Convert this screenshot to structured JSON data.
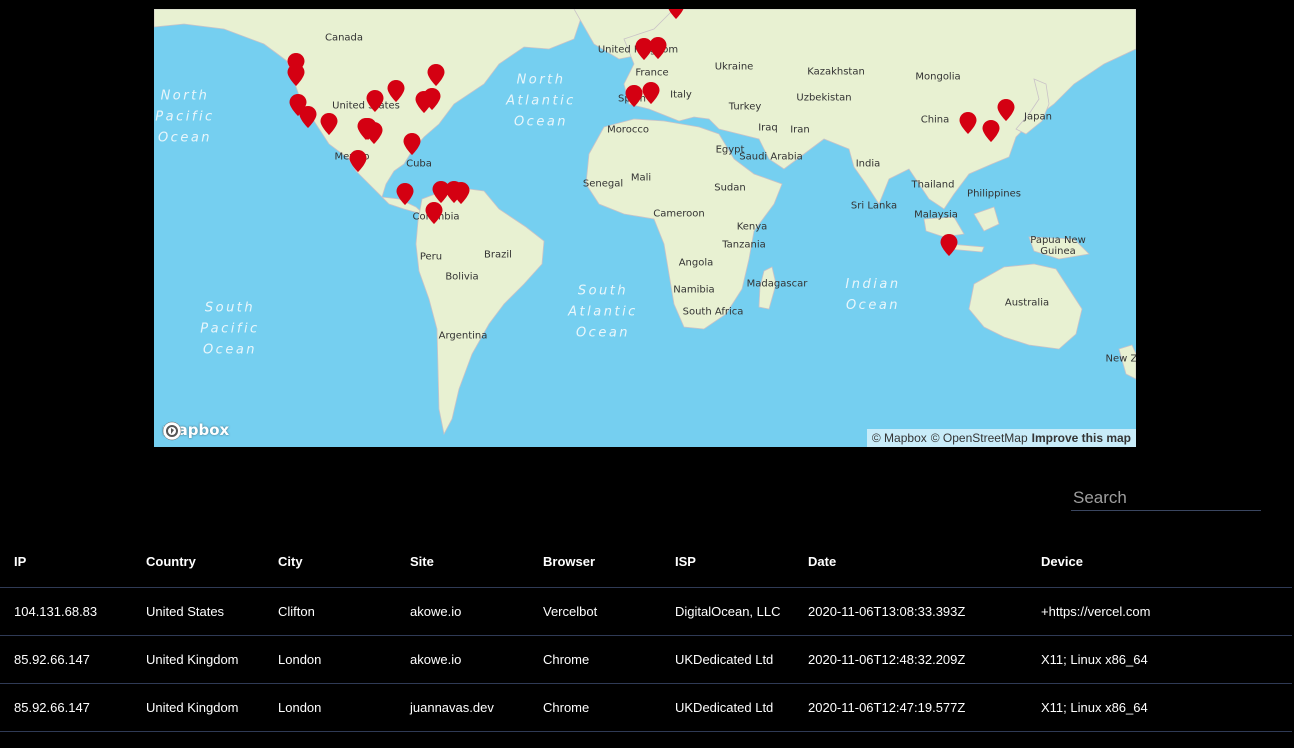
{
  "map": {
    "logo_text": "mapbox",
    "attribution": {
      "mapbox": "© Mapbox",
      "osm": "© OpenStreetMap",
      "improve": "Improve this map"
    },
    "colors": {
      "water": "#75cff0",
      "land": "#e8f1d2",
      "marker": "#d40012"
    },
    "labels": [
      {
        "id": "canada",
        "text": "Canada"
      },
      {
        "id": "united-states",
        "text": "Uni⁠ted States"
      },
      {
        "id": "mexico",
        "text": "Mexico"
      },
      {
        "id": "cuba",
        "text": "Cuba"
      },
      {
        "id": "colombia",
        "text": "Colombia"
      },
      {
        "id": "peru",
        "text": "Peru"
      },
      {
        "id": "brazil",
        "text": "Brazil"
      },
      {
        "id": "bolivia",
        "text": "Bolivia"
      },
      {
        "id": "argentina",
        "text": "Argentina"
      },
      {
        "id": "united-kingdom",
        "text": "United Kingdom"
      },
      {
        "id": "france",
        "text": "France"
      },
      {
        "id": "spain",
        "text": "Spain"
      },
      {
        "id": "italy",
        "text": "Italy"
      },
      {
        "id": "ukraine",
        "text": "Ukraine"
      },
      {
        "id": "turkey",
        "text": "Turkey"
      },
      {
        "id": "kazakhstan",
        "text": "Kazakhstan"
      },
      {
        "id": "mongolia",
        "text": "Mongolia"
      },
      {
        "id": "uzbekistan",
        "text": "Uzbekistan"
      },
      {
        "id": "iraq",
        "text": "Iraq"
      },
      {
        "id": "iran",
        "text": "Iran"
      },
      {
        "id": "china",
        "text": "China"
      },
      {
        "id": "japan",
        "text": "Japan"
      },
      {
        "id": "morocco",
        "text": "Morocco"
      },
      {
        "id": "egypt",
        "text": "Egypt"
      },
      {
        "id": "saudi-arabia",
        "text": "Saudi Arabia"
      },
      {
        "id": "india",
        "text": "India"
      },
      {
        "id": "thailand",
        "text": "Thailand"
      },
      {
        "id": "philippines",
        "text": "Philippines"
      },
      {
        "id": "sri-lanka",
        "text": "Sri Lanka"
      },
      {
        "id": "malaysia",
        "text": "Malaysia"
      },
      {
        "id": "mali",
        "text": "Mali"
      },
      {
        "id": "senegal",
        "text": "Senegal"
      },
      {
        "id": "sudan",
        "text": "Sudan"
      },
      {
        "id": "cameroon",
        "text": "Cameroon"
      },
      {
        "id": "kenya",
        "text": "Kenya"
      },
      {
        "id": "tanzania",
        "text": "Tanzania"
      },
      {
        "id": "angola",
        "text": "Angola"
      },
      {
        "id": "namibia",
        "text": "Namibia"
      },
      {
        "id": "south-africa",
        "text": "South Africa"
      },
      {
        "id": "madagascar",
        "text": "Madagascar"
      },
      {
        "id": "papua-new-guinea",
        "text": "Papua New\nGuinea"
      },
      {
        "id": "australia",
        "text": "Australia"
      },
      {
        "id": "new-zealand",
        "text": "New Zeala"
      }
    ],
    "oceans": [
      {
        "id": "north-pacific",
        "text": "North\nPacific\nOcean"
      },
      {
        "id": "north-atlantic",
        "text": "North\nAtlantic\nOcean"
      },
      {
        "id": "south-pacific",
        "text": "South\nPacific\nOcean"
      },
      {
        "id": "south-atlantic",
        "text": "South\nAtlantic\nOcean"
      },
      {
        "id": "indian",
        "text": "Indian\nOcean"
      }
    ]
  },
  "search": {
    "placeholder": "Search",
    "value": ""
  },
  "table": {
    "columns": [
      "IP",
      "Country",
      "City",
      "Site",
      "Browser",
      "ISP",
      "Date",
      "Device"
    ],
    "rows": [
      [
        "104.131.68.83",
        "United States",
        "Clifton",
        "akowe.io",
        "Vercelbot",
        "DigitalOcean, LLC",
        "2020-11-06T13:08:33.393Z",
        "+https://vercel.com"
      ],
      [
        "85.92.66.147",
        "United Kingdom",
        "London",
        "akowe.io",
        "Chrome",
        "UKDedicated Ltd",
        "2020-11-06T12:48:32.209Z",
        "X11; Linux x86_64"
      ],
      [
        "85.92.66.147",
        "United Kingdom",
        "London",
        "juannavas.dev",
        "Chrome",
        "UKDedicated Ltd",
        "2020-11-06T12:47:19.577Z",
        "X11; Linux x86_64"
      ]
    ]
  }
}
